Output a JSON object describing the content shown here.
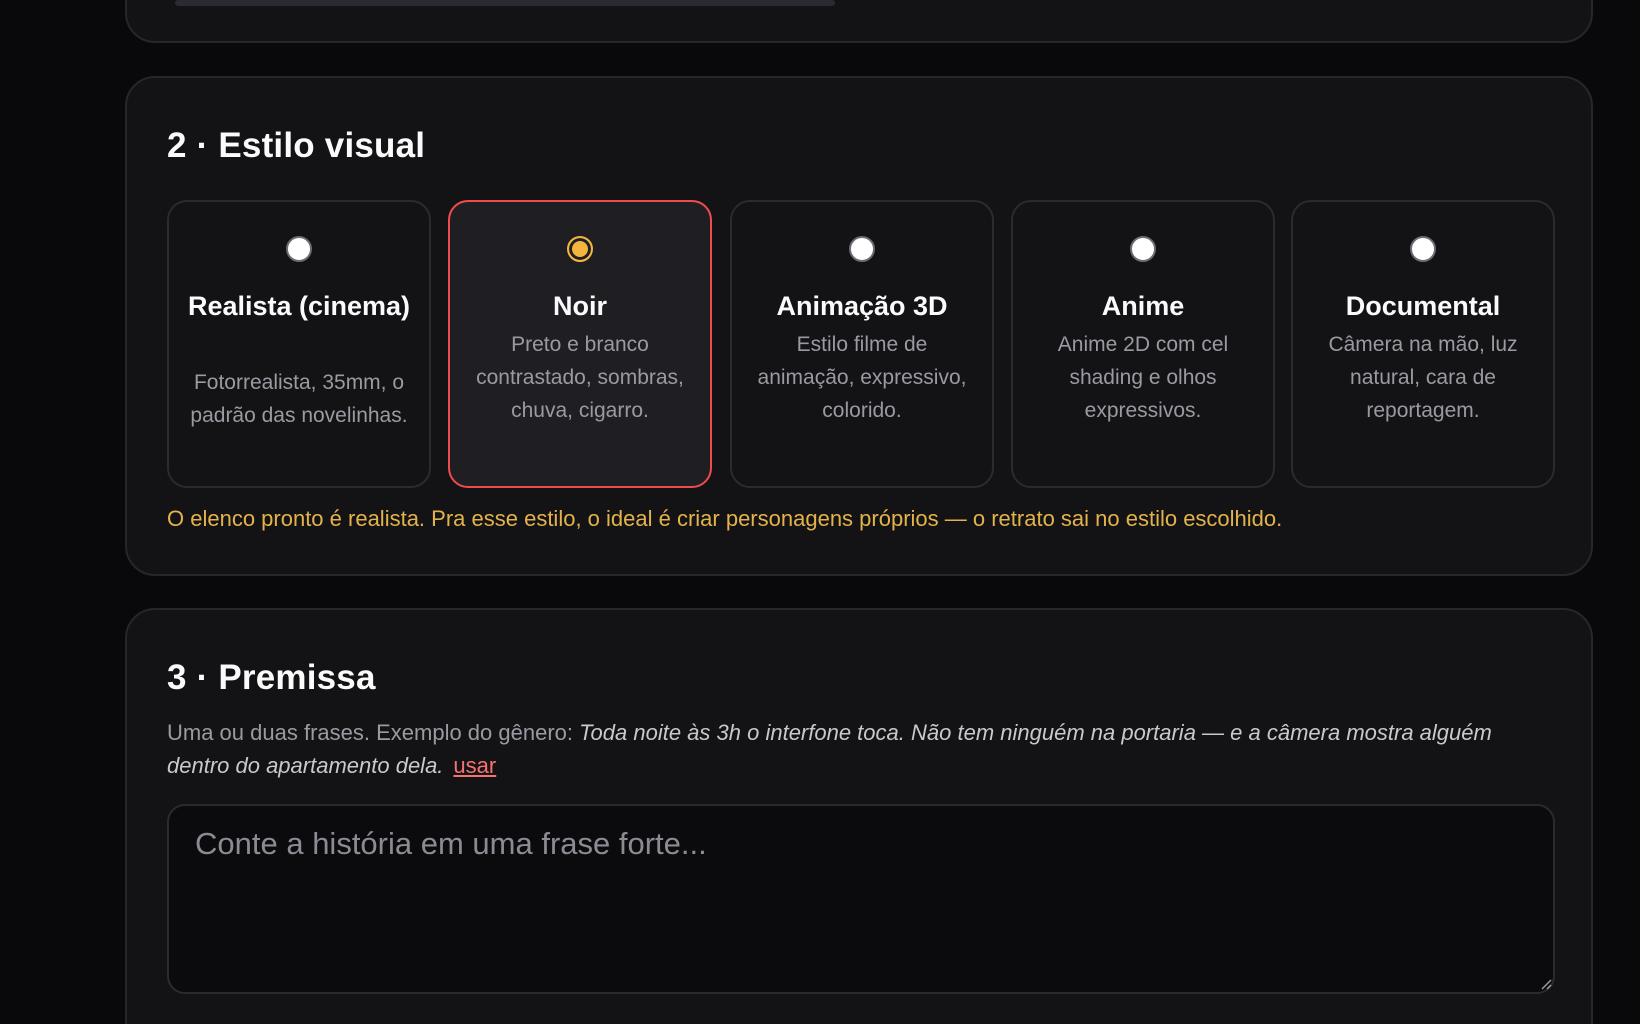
{
  "style_section": {
    "title": "2 · Estilo visual",
    "options": [
      {
        "title": "Realista (cinema)",
        "description": "Fotorrealista, 35mm, o padrão das novelinhas.",
        "selected": false
      },
      {
        "title": "Noir",
        "description": "Preto e branco contrastado, sombras, chuva, cigarro.",
        "selected": true
      },
      {
        "title": "Animação 3D",
        "description": "Estilo filme de animação, expressivo, colorido.",
        "selected": false
      },
      {
        "title": "Anime",
        "description": "Anime 2D com cel shading e olhos expressivos.",
        "selected": false
      },
      {
        "title": "Documental",
        "description": "Câmera na mão, luz natural, cara de reportagem.",
        "selected": false
      }
    ],
    "notice": "O elenco pronto é realista. Pra esse estilo, o ideal é criar personagens próprios — o retrato sai no estilo escolhido."
  },
  "premise_section": {
    "title": "3 · Premissa",
    "hint_lead": "Uma ou duas frases. Exemplo do gênero: ",
    "hint_example": "Toda noite às 3h o interfone toca. Não tem ninguém na portaria — e a câmera mostra alguém dentro do apartamento dela.",
    "use_link": "usar",
    "textarea_placeholder": "Conte a história em uma frase forte...",
    "textarea_value": ""
  },
  "colors": {
    "accent_selected_border": "#ef4d4d",
    "radio_checked": "#f3b53f",
    "notice": "#e4b24b",
    "link": "#f87171"
  }
}
